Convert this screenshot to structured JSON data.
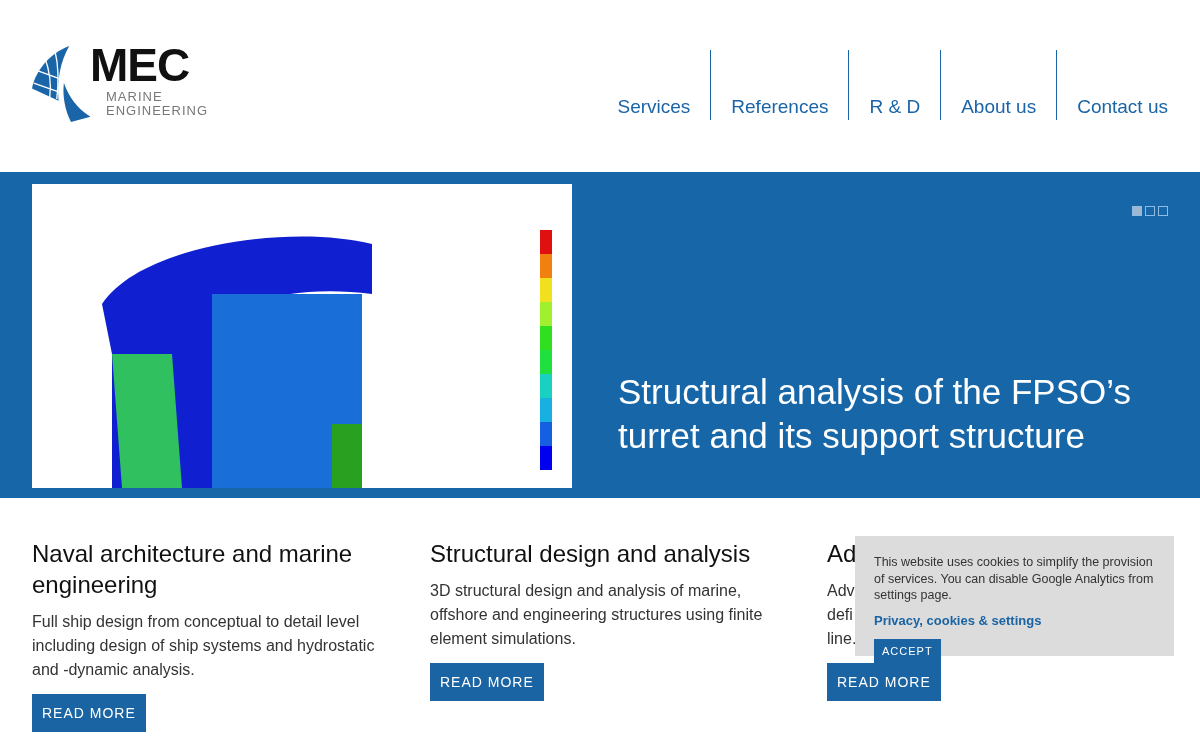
{
  "logo": {
    "name": "MEC",
    "subtitle_1": "MARINE",
    "subtitle_2": "ENGINEERING"
  },
  "nav": [
    {
      "label": "Services"
    },
    {
      "label": "References"
    },
    {
      "label": "R & D"
    },
    {
      "label": "About us"
    },
    {
      "label": "Contact us"
    }
  ],
  "hero": {
    "headline": "Structural analysis of the FPSO’s turret and its support structure",
    "slides": [
      {
        "selected": true
      },
      {
        "selected": false
      },
      {
        "selected": false
      }
    ]
  },
  "cards": [
    {
      "title": "Naval architecture and marine engineering",
      "body": [
        "Full ship design from conceptual to detail level including design of ship systems and hydrostatic and -dynamic analysis."
      ],
      "button": "READ MORE"
    },
    {
      "title": "Structural design and analysis",
      "body": [
        "3D structural design and analysis of marine, offshore and engineering structures using finite element simulations."
      ],
      "button": "READ MORE"
    },
    {
      "title": "Ad",
      "body": [
        "Adv",
        "defi",
        "line."
      ],
      "button": "READ MORE"
    }
  ],
  "cookie_notice": {
    "text": "This website uses cookies to simplify the provision of services. You can disable Google Analytics from settings page.",
    "link": "Privacy, cookies & settings",
    "button": "ACCEPT"
  }
}
